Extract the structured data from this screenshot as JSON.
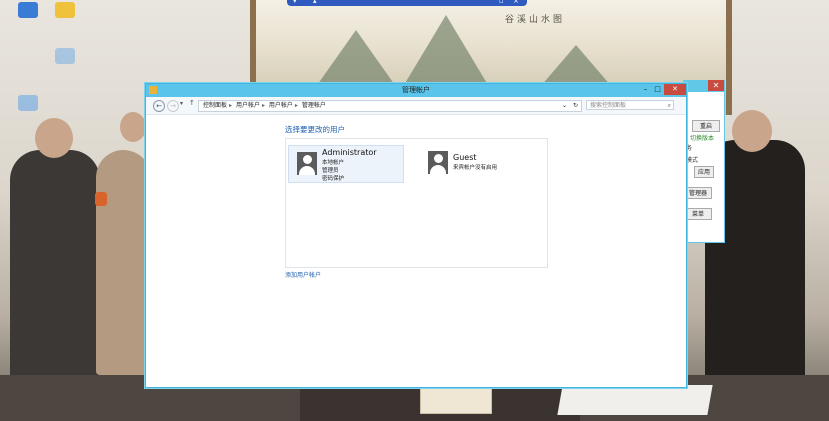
{
  "background": {
    "calligraphy": "谷溪山水图"
  },
  "main_window": {
    "title": "管理帐户",
    "controls": {
      "minimize": "–",
      "maximize": "□",
      "close": "✕"
    },
    "address": {
      "crumbs": [
        "控制面板",
        "用户帐户",
        "用户帐户",
        "管理帐户"
      ],
      "refresh": "↻",
      "dropdown": "⌄"
    },
    "search_placeholder": "搜索控制面板",
    "heading": "选择要更改的用户",
    "accounts": [
      {
        "name": "Administrator",
        "lines": [
          "本地帐户",
          "管理员",
          "密码保护"
        ]
      },
      {
        "name": "Guest",
        "lines": [
          "来宾帐户没有启用"
        ]
      }
    ],
    "add_link": "添加用户帐户"
  },
  "back_window": {
    "close": "✕",
    "buttons": [
      "重启",
      "应用",
      "管理器",
      "菜单"
    ],
    "texts": [
      "切换版本",
      "务",
      "模式"
    ]
  }
}
